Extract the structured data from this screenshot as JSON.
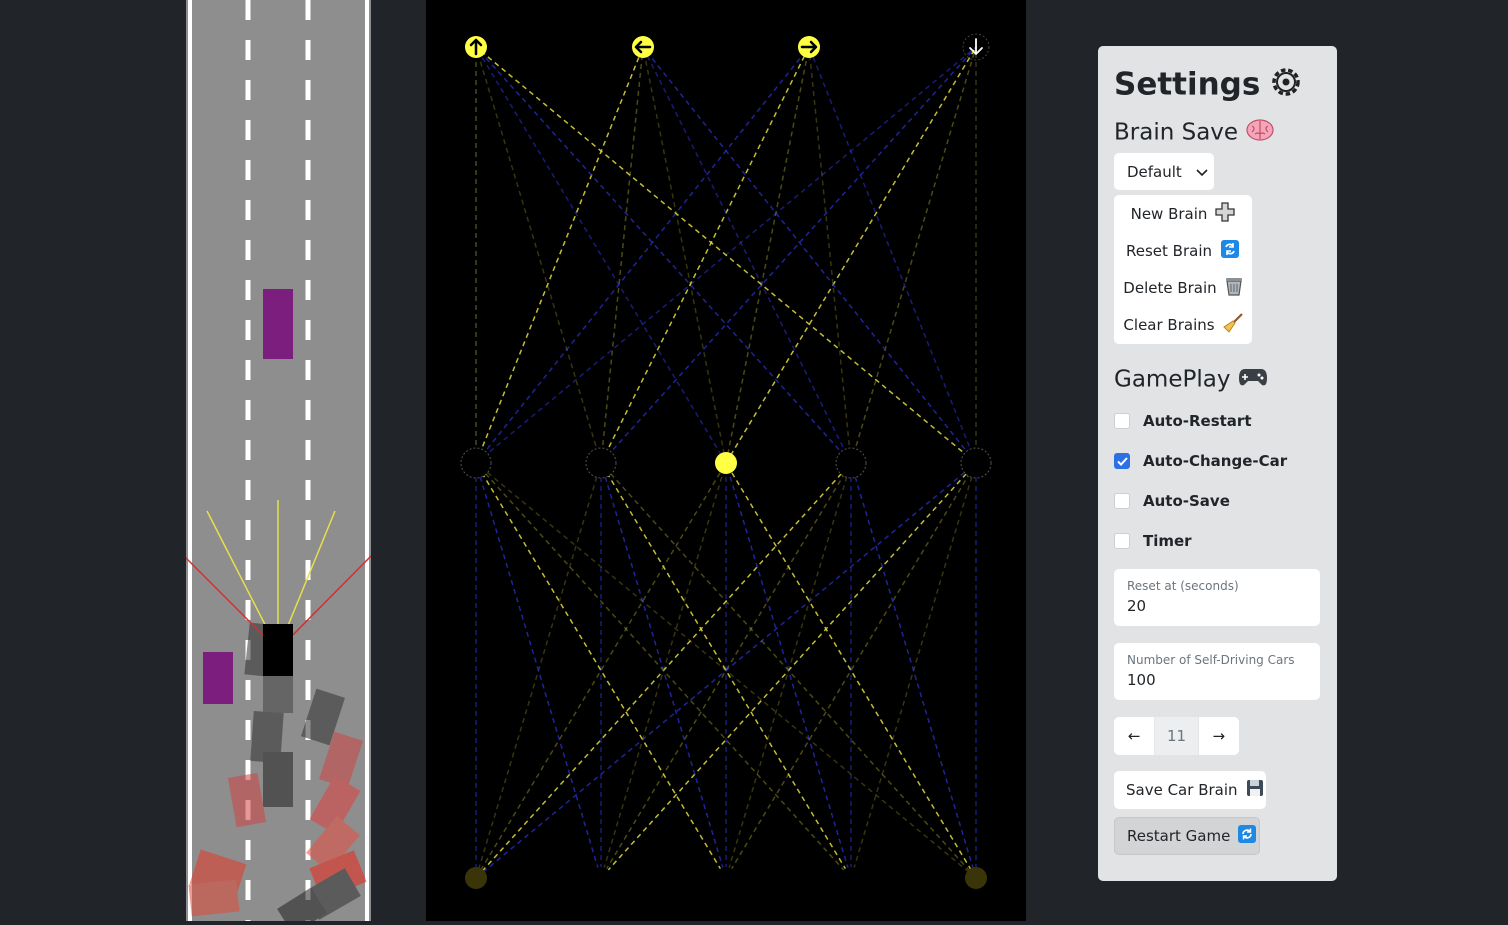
{
  "network": {
    "output_icons": [
      "arrow-up-icon",
      "arrow-left-icon",
      "arrow-right-icon",
      "arrow-down-icon"
    ]
  },
  "settings": {
    "title": "Settings",
    "title_icon": "gear-icon",
    "brain_save": {
      "heading": "Brain Save",
      "heading_icon": "brain-icon",
      "dropdown_value": "Default",
      "menu": [
        {
          "label": "New Brain",
          "icon": "plus-icon"
        },
        {
          "label": "Reset Brain",
          "icon": "repeat-icon"
        },
        {
          "label": "Delete Brain",
          "icon": "wastebasket-icon"
        },
        {
          "label": "Clear Brains",
          "icon": "broom-icon"
        }
      ]
    },
    "gameplay": {
      "heading": "GamePlay",
      "heading_icon": "gamepad-icon",
      "options": [
        {
          "label": "Auto-Restart",
          "checked": false
        },
        {
          "label": "Auto-Change-Car",
          "checked": true
        },
        {
          "label": "Auto-Save",
          "checked": false
        },
        {
          "label": "Timer",
          "checked": false
        }
      ],
      "reset_label": "Reset at (seconds)",
      "reset_value": "20",
      "cars_label": "Number of Self-Driving Cars",
      "cars_value": "100",
      "pager_prev": "←",
      "pager_value": "11",
      "pager_next": "→",
      "save_button": "Save Car Brain",
      "save_icon": "floppy-disk-icon",
      "restart_button": "Restart Game",
      "restart_icon": "refresh-icon"
    }
  },
  "colors": {
    "background": "#212529",
    "road": "#8e8e8e",
    "traffic_car": "#7b1e7e",
    "sensor": "#e6e04a",
    "weight_positive": "#d8d33a",
    "weight_negative": "#2a34d8",
    "active_node": "#ffff44",
    "checkbox_accent": "#2f6fe4"
  }
}
